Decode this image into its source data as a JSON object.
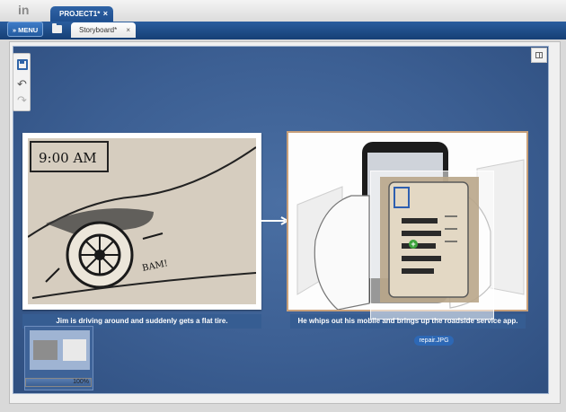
{
  "window": {
    "project_tab": "PROJECT1*",
    "close_glyph": "×"
  },
  "toolbar": {
    "menu_label": "» MENU",
    "doc_tab": "Storyboard*"
  },
  "side_tools": {
    "icons": [
      "save-icon",
      "undo-icon",
      "redo-icon"
    ],
    "undo_glyph": "↶",
    "redo_glyph": "↷"
  },
  "panels": [
    {
      "caption": "Jim is driving around and suddenly gets a flat tire.",
      "sketch_text": [
        "9:00 AM",
        "BAM!"
      ]
    },
    {
      "caption": "He whips out his mobile and brings up the roadside service app."
    }
  ],
  "drag": {
    "file_label": "repair.JPG",
    "cursor_glyph": "+"
  },
  "navigator": {
    "zoom": "100%",
    "zoom_level": 1.0
  },
  "colors": {
    "canvas": "#3c5f93",
    "caption_bar": "#365d92",
    "accent": "#2d68b5",
    "selection_border": "#c8a07a"
  }
}
